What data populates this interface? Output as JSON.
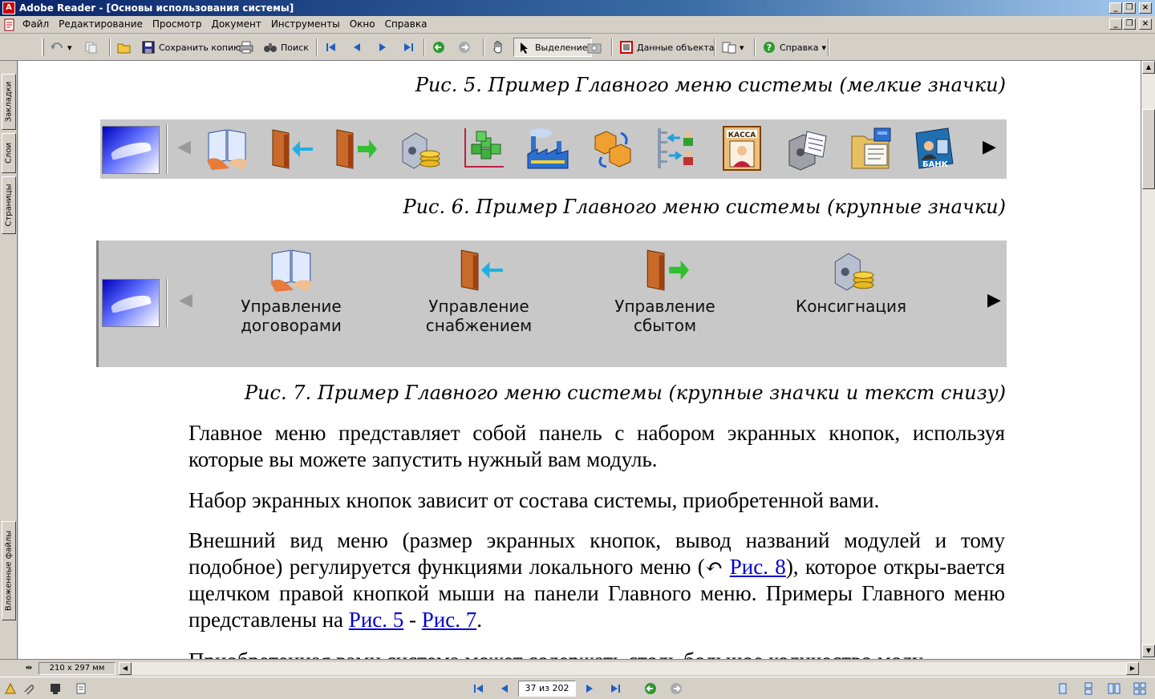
{
  "window": {
    "title": "Adobe Reader - [Основы использования системы]",
    "app_icon_glyph": "A",
    "min_glyph": "_",
    "restore_glyph": "❐",
    "close_glyph": "×"
  },
  "menubar": {
    "items": [
      "Файл",
      "Редактирование",
      "Просмотр",
      "Документ",
      "Инструменты",
      "Окно",
      "Справка"
    ]
  },
  "toolbar": {
    "save_copy_label": "Сохранить копию",
    "search_label": "Поиск",
    "select_label": "Выделение",
    "object_data_label": "Данные объекта",
    "help_label": "Справка",
    "dropdown_glyph": "▾"
  },
  "leftnav": {
    "tabs": [
      "Закладки",
      "Слои",
      "Страницы",
      "Вложенные файлы"
    ]
  },
  "document": {
    "caption5": "Рис. 5. Пример Главного меню системы (мелкие значки)",
    "caption6": "Рис. 6. Пример Главного меню системы (крупные значки)",
    "caption7": "Рис. 7. Пример Главного меню системы (крупные значки и текст снизу)",
    "strip_left_arrow": "◀",
    "strip_right_arrow": "▶",
    "big_items": [
      {
        "line1": "Управление",
        "line2": "договорами"
      },
      {
        "line1": "Управление",
        "line2": "снабжением"
      },
      {
        "line1": "Управление",
        "line2": "сбытом"
      },
      {
        "line1": "Консигнация",
        "line2": ""
      }
    ],
    "small_icon_bank_label": "БАНК",
    "small_icon_kassa_label": "КАССА",
    "para1": "Главное меню представляет собой панель с набором экранных кнопок, используя которые вы можете запустить нужный вам модуль.",
    "para2": "Набор экранных кнопок зависит от состава системы, приобретенной вами.",
    "para3_a": "Внешний вид меню (размер экранных кнопок, вывод названий модулей и тому подобное) регулируется функциями локального меню (",
    "para3_link1": "Рис. 8",
    "para3_b": "), которое откры-вается щелчком правой кнопкой мыши на панели Главного меню. Примеры Главного меню представлены на ",
    "para3_link2": "Рис. 5",
    "para3_dash": " - ",
    "para3_link3": "Рис. 7",
    "para3_end": ".",
    "para4_partial": "Приобретенная вами система может содержать столь большое количество моду-"
  },
  "statusbar": {
    "page_size": "210 x 297 мм",
    "page_indicator": "37 из 202"
  },
  "colors": {
    "title_bar": "#0a246a",
    "link": "#0000cc",
    "strip_bg": "#c8c8c8"
  }
}
